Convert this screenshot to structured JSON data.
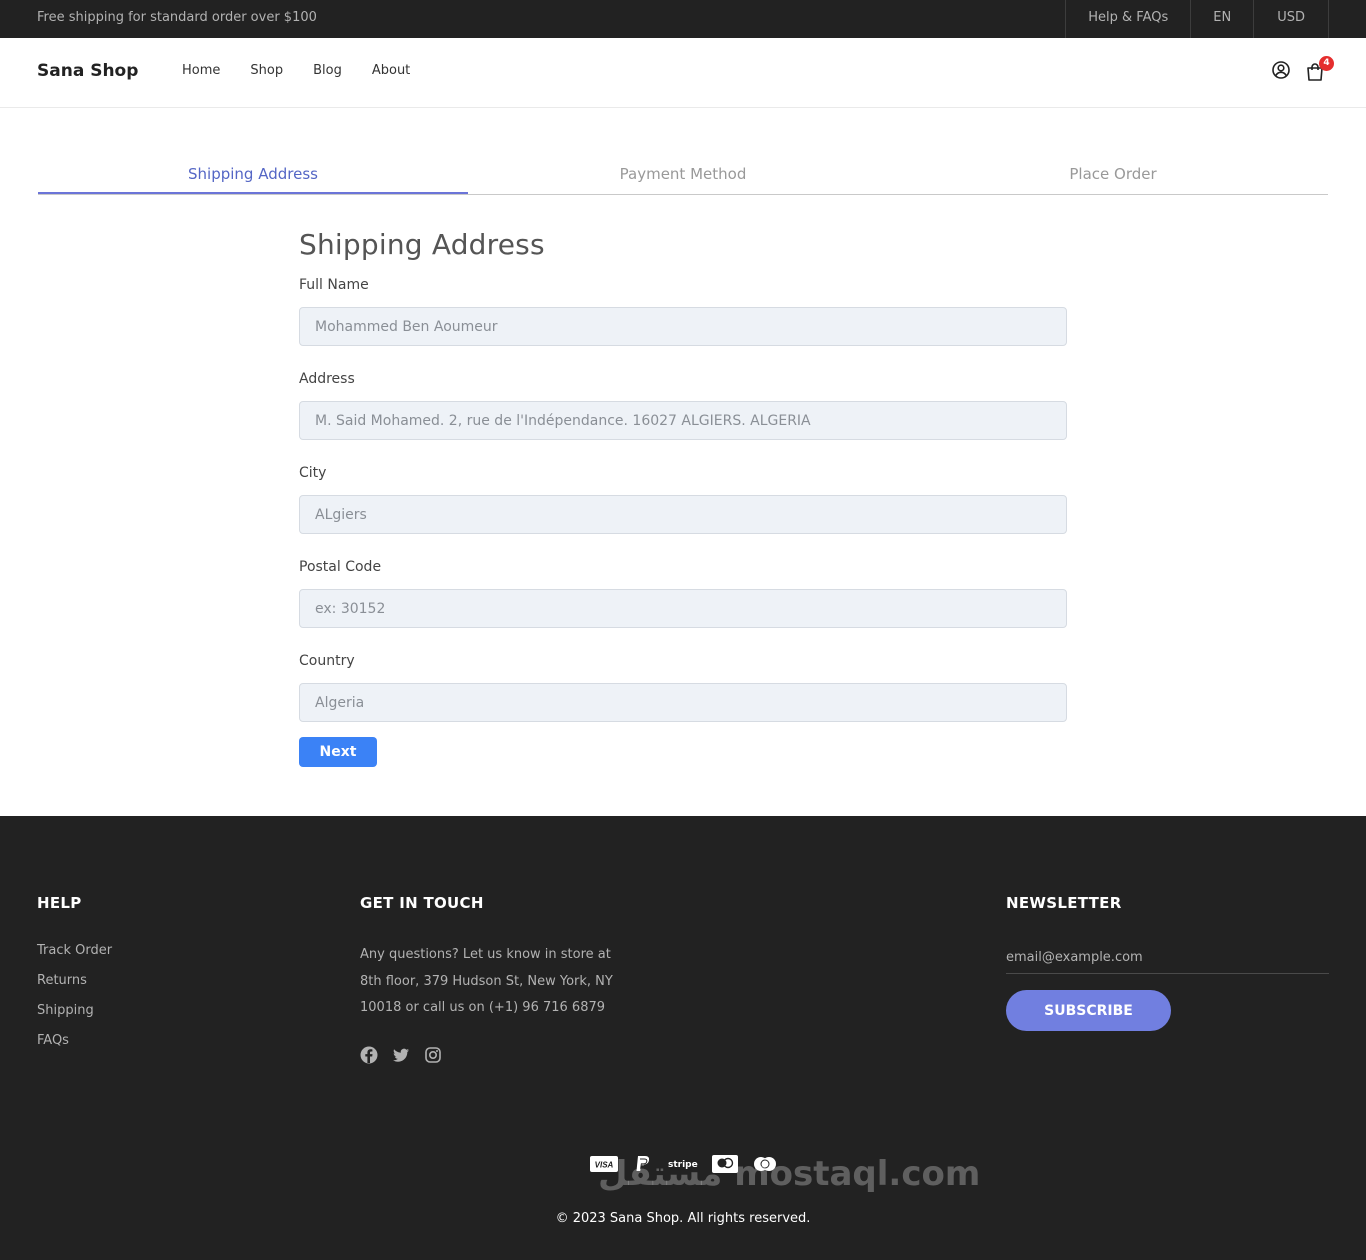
{
  "topbar": {
    "promo": "Free shipping for standard order over $100",
    "links": [
      "Help & FAQs",
      "EN",
      "USD"
    ]
  },
  "header": {
    "logo": "Sana Shop",
    "nav": [
      "Home",
      "Shop",
      "Blog",
      "About"
    ],
    "cart_count": "4",
    "icons": [
      "user-icon",
      "cart-icon"
    ]
  },
  "steps": [
    {
      "label": "Shipping Address",
      "active": true
    },
    {
      "label": "Payment Method",
      "active": false
    },
    {
      "label": "Place Order",
      "active": false
    }
  ],
  "form": {
    "title": "Shipping Address",
    "fields": [
      {
        "label": "Full Name",
        "placeholder": "Mohammed Ben Aoumeur"
      },
      {
        "label": "Address",
        "placeholder": "M. Said Mohamed. 2, rue de l'Indépendance. 16027 ALGIERS. ALGERIA"
      },
      {
        "label": "City",
        "placeholder": "ALgiers"
      },
      {
        "label": "Postal Code",
        "placeholder": "ex: 30152"
      },
      {
        "label": "Country",
        "placeholder": "Algeria"
      }
    ],
    "next_label": "Next"
  },
  "footer": {
    "help": {
      "title": "HELP",
      "links": [
        "Track Order",
        "Returns",
        "Shipping",
        "FAQs"
      ]
    },
    "touch": {
      "title": "GET IN TOUCH",
      "text": "Any questions? Let us know in store at 8th floor, 379 Hudson St, New York, NY 10018 or call us on (+1) 96 716 6879",
      "social_icons": [
        "facebook-icon",
        "twitter-icon",
        "instagram-icon"
      ]
    },
    "newsletter": {
      "title": "NEWSLETTER",
      "placeholder": "email@example.com",
      "button": "SUBSCRIBE"
    },
    "payments": [
      "VISA",
      "PayPal",
      "stripe",
      "amex",
      "mastercard"
    ],
    "copyright": "© 2023 Sana Shop. All rights reserved.",
    "watermark": "مستقل mostaql.com"
  },
  "colors": {
    "accent": "#5466c5",
    "next_button": "#3b82f6",
    "subscribe_button": "#717fe0",
    "dark_bg": "#222222",
    "badge": "#e52e2e"
  }
}
